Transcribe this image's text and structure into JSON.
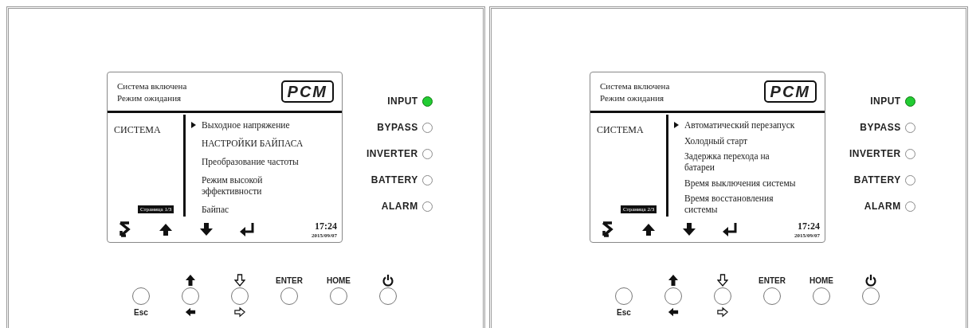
{
  "panels": [
    {
      "screen": {
        "status_lines": [
          "Система включена",
          "Режим ожидания"
        ],
        "logo": "PCM",
        "category": "СИСТЕМА",
        "page_label": "Страница 1/3",
        "menu_items": [
          {
            "label": "Выходное напряжение",
            "selected": true
          },
          {
            "label": "НАСТРОЙКИ БАЙПАСА",
            "selected": false
          },
          {
            "label": "Преобразование частоты",
            "selected": false
          },
          {
            "label": "Режим высокой эффективности",
            "selected": false
          },
          {
            "label": "Байпас",
            "selected": false
          }
        ],
        "time": "17:24",
        "date": "2015/09/07"
      },
      "leds": [
        {
          "label": "INPUT",
          "on": true
        },
        {
          "label": "BYPASS",
          "on": false
        },
        {
          "label": "INVERTER",
          "on": false
        },
        {
          "label": "BATTERY",
          "on": false
        },
        {
          "label": "ALARM",
          "on": false
        }
      ],
      "keys": [
        {
          "kind": "esc",
          "label": "Esc"
        },
        {
          "kind": "up-left"
        },
        {
          "kind": "down-right"
        },
        {
          "kind": "text",
          "label": "ENTER"
        },
        {
          "kind": "text",
          "label": "HOME"
        },
        {
          "kind": "power"
        }
      ]
    },
    {
      "screen": {
        "status_lines": [
          "Система включена",
          "Режим ожидания"
        ],
        "logo": "PCM",
        "category": "СИСТЕМА",
        "page_label": "Страница 2/3",
        "menu_items": [
          {
            "label": "Автоматический перезапуск",
            "selected": true
          },
          {
            "label": "Холодный старт",
            "selected": false
          },
          {
            "label": "Задержка перехода на батареи",
            "selected": false
          },
          {
            "label": "Время выключения системы",
            "selected": false
          },
          {
            "label": "Время восстановления системы",
            "selected": false
          }
        ],
        "time": "17:24",
        "date": "2015/09/07"
      },
      "leds": [
        {
          "label": "INPUT",
          "on": true
        },
        {
          "label": "BYPASS",
          "on": false
        },
        {
          "label": "INVERTER",
          "on": false
        },
        {
          "label": "BATTERY",
          "on": false
        },
        {
          "label": "ALARM",
          "on": false
        }
      ],
      "keys": [
        {
          "kind": "esc",
          "label": "Esc"
        },
        {
          "kind": "up-left"
        },
        {
          "kind": "down-right"
        },
        {
          "kind": "text",
          "label": "ENTER"
        },
        {
          "kind": "text",
          "label": "HOME"
        },
        {
          "kind": "power"
        }
      ]
    }
  ]
}
